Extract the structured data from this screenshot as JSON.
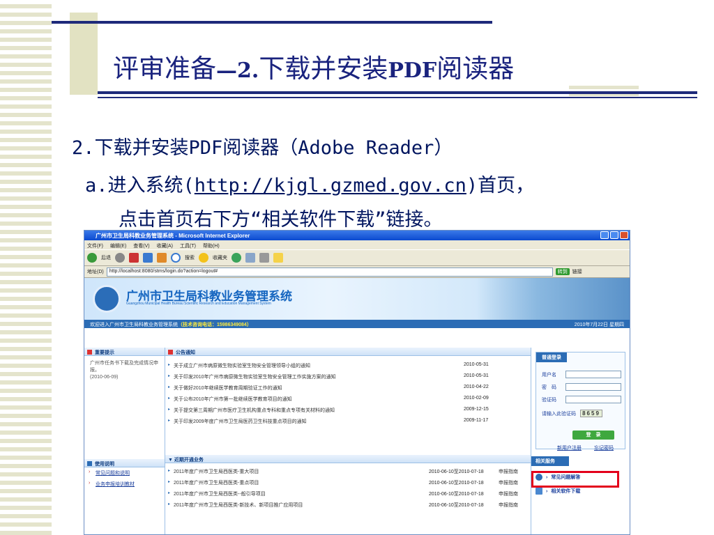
{
  "slide": {
    "title_cn": "评审准备",
    "title_dash": "—",
    "title_num": "2.",
    "title_rest": "下载并安装",
    "title_pdf": "PDF",
    "title_tail": "阅读器",
    "line1": "2.下载并安装PDF阅读器（Adobe Reader）",
    "line2_pre": "a.进入系统(",
    "line2_url": "http://kjgl.gzmed.gov.cn",
    "line2_post": ")首页，",
    "line3": "点击首页右下方“相关软件下载”链接。"
  },
  "browser": {
    "window_title": "广州市卫生局科教业务管理系统 - Microsoft Internet Explorer",
    "menu": [
      "文件(F)",
      "编辑(E)",
      "查看(V)",
      "收藏(A)",
      "工具(T)",
      "帮助(H)"
    ],
    "toolbar": [
      "后退",
      "搜索",
      "收藏夹"
    ],
    "address_label": "地址(D)",
    "address": "http://localhost:8080/stms/login.do?action=logout#",
    "go_label": "转到",
    "links_label": "链接"
  },
  "site": {
    "banner_title": "广州市卫生局科教业务管理系统",
    "banner_sub": "Guangzhou Municipal Health Bureau Scientific Research and Education Management System",
    "welcome": "欢迎进入广州市卫生局科教业务管理系统",
    "hotline": "（技术咨询电话：15986349084）",
    "date": "2010年7月22日 星期四",
    "important_title": "重要提示",
    "important_note": "广州市任务书下载及完成情况申报。",
    "important_date": "(2010-06-09)",
    "guide_title": "使用说明",
    "guide_items": [
      "常见问题和说明",
      "业务申报培训教材"
    ],
    "notice_title": "公告通知",
    "notices": [
      {
        "title": "关于成立广州市病原微生物实验室生物安全管理领导小组的通知",
        "date": "2010-05-31"
      },
      {
        "title": "关于印发2010年广州市病原微生物实验室生物安全管理工作实施方案的通知",
        "date": "2010-05-31"
      },
      {
        "title": "关于做好2010年继续医学教育周期验证工作的通知",
        "date": "2010-04-22"
      },
      {
        "title": "关于公布2010年广州市第一批继续医学教育项目的通知",
        "date": "2010-02-09"
      },
      {
        "title": "关于提交第三周期广州市医疗卫生机构重点专科和重点专项有关材料的通知",
        "date": "2009-12-15"
      },
      {
        "title": "关于印发2009年度广州市卫生局医药卫生科技重点项目的通知",
        "date": "2009-11-17"
      }
    ],
    "recent_title": "近期开通业务",
    "recent": [
      {
        "title": "2011年度广州市卫生局西医类-重大项目",
        "dates": "2010-06-10至2010-07-18",
        "guide": "申报指南"
      },
      {
        "title": "2011年度广州市卫生局西医类-重点项目",
        "dates": "2010-06-10至2010-07-18",
        "guide": "申报指南"
      },
      {
        "title": "2011年度广州市卫生局西医类--般引导项目",
        "dates": "2010-06-10至2010-07-18",
        "guide": "申报指南"
      },
      {
        "title": "2011年度广州市卫生局西医类-新技术、新项目推广应用项目",
        "dates": "2010-06-10至2010-07-18",
        "guide": "申报指南"
      }
    ],
    "login": {
      "title": "普通登录",
      "user_label": "用户名",
      "pass_label": "密　码",
      "code_label": "验证码",
      "code_hint": "请输入此验证码",
      "captcha": "8659",
      "submit": "登　录",
      "register": "新用户注册",
      "forgot": "忘记密码"
    },
    "related_title": "相关服务",
    "related": [
      "常见问题解答",
      "相关软件下载"
    ]
  },
  "colors": {
    "accent": "#1a237e",
    "highlight": "#e3001b",
    "site_blue": "#2b6cb5"
  }
}
